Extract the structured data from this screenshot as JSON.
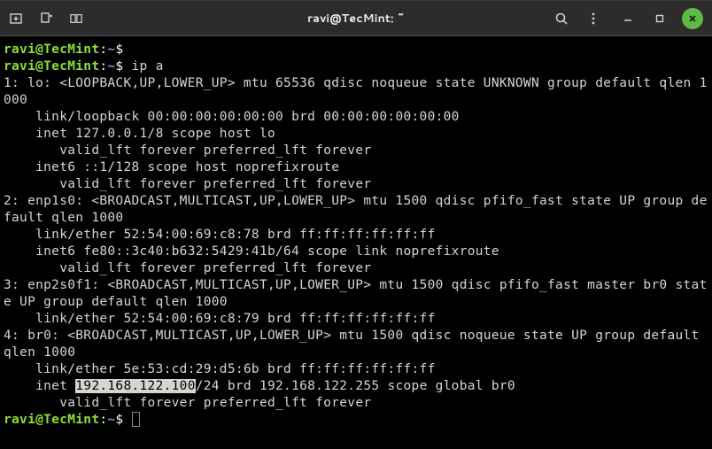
{
  "titlebar": {
    "title": "ravi@TecMint: ~"
  },
  "prompt": {
    "userhost": "ravi@TecMint",
    "colon": ":",
    "path": "~",
    "symbol": "$"
  },
  "command": "ip a",
  "output": {
    "l1": "1: lo: <LOOPBACK,UP,LOWER_UP> mtu 65536 qdisc noqueue state UNKNOWN group default qlen 1000",
    "l2": "    link/loopback 00:00:00:00:00:00 brd 00:00:00:00:00:00",
    "l3": "    inet 127.0.0.1/8 scope host lo",
    "l4": "       valid_lft forever preferred_lft forever",
    "l5": "    inet6 ::1/128 scope host noprefixroute",
    "l6": "       valid_lft forever preferred_lft forever",
    "l7": "2: enp1s0: <BROADCAST,MULTICAST,UP,LOWER_UP> mtu 1500 qdisc pfifo_fast state UP group default qlen 1000",
    "l8": "    link/ether 52:54:00:69:c8:78 brd ff:ff:ff:ff:ff:ff",
    "l9": "    inet6 fe80::3c40:b632:5429:41b/64 scope link noprefixroute",
    "l10": "       valid_lft forever preferred_lft forever",
    "l11": "3: enp2s0f1: <BROADCAST,MULTICAST,UP,LOWER_UP> mtu 1500 qdisc pfifo_fast master br0 state UP group default qlen 1000",
    "l12": "    link/ether 52:54:00:69:c8:79 brd ff:ff:ff:ff:ff:ff",
    "l13": "4: br0: <BROADCAST,MULTICAST,UP,LOWER_UP> mtu 1500 qdisc noqueue state UP group default qlen 1000",
    "l14": "    link/ether 5e:53:cd:29:d5:6b brd ff:ff:ff:ff:ff:ff",
    "l15_pre": "    inet ",
    "l15_hl": "192.168.122.100",
    "l15_post": "/24 brd 192.168.122.255 scope global br0",
    "l16": "       valid_lft forever preferred_lft forever"
  }
}
